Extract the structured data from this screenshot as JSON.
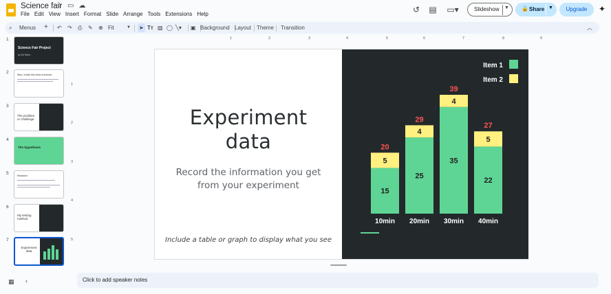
{
  "app": {
    "doc_title": "Science fair",
    "menu": [
      "File",
      "Edit",
      "View",
      "Insert",
      "Format",
      "Slide",
      "Arrange",
      "Tools",
      "Extensions",
      "Help"
    ],
    "slideshow_label": "Slideshow",
    "share_label": "Share",
    "upgrade_label": "Upgrade"
  },
  "toolbar": {
    "menus_label": "Menus",
    "zoom_label": "Fit",
    "background_label": "Background",
    "layout_label": "Layout",
    "theme_label": "Theme",
    "transition_label": "Transition"
  },
  "ruler": {
    "h": [
      "1",
      "2",
      "3",
      "4",
      "5",
      "6",
      "7",
      "8",
      "9"
    ],
    "v": [
      "1",
      "2",
      "3",
      "4",
      "5"
    ]
  },
  "filmstrip": {
    "numbers": [
      "1",
      "2",
      "3",
      "4",
      "5",
      "6",
      "7"
    ],
    "selected": 7,
    "thumbs": [
      {
        "title": "Science Fair Project",
        "sub": "by Sir Stern"
      },
      {
        "title": "Why I chose this area of science"
      },
      {
        "title": "The problem or challenge"
      },
      {
        "title": "The hypothesis"
      },
      {
        "title": "Research"
      },
      {
        "title": "My testing method"
      },
      {
        "title": "Experiment data"
      }
    ]
  },
  "slide": {
    "title": "Experiment data",
    "subtitle": "Record the information you get from your experiment",
    "footnote": "Include a table or graph to display what you see"
  },
  "notes": {
    "placeholder": "Click to add speaker notes"
  },
  "chart_data": {
    "type": "bar",
    "stacked": true,
    "categories": [
      "10min",
      "20min",
      "30min",
      "40min"
    ],
    "series": [
      {
        "name": "Item 1",
        "values": [
          15,
          25,
          35,
          22
        ],
        "color": "#5fd595"
      },
      {
        "name": "Item 2",
        "values": [
          5,
          4,
          4,
          5
        ],
        "color": "#fff07f"
      }
    ],
    "totals": [
      20,
      29,
      39,
      27
    ],
    "total_color": "#ff5252",
    "ylim": [
      0,
      39
    ],
    "grid": false,
    "legend": "top-right",
    "title": "",
    "xlabel": "",
    "ylabel": ""
  }
}
